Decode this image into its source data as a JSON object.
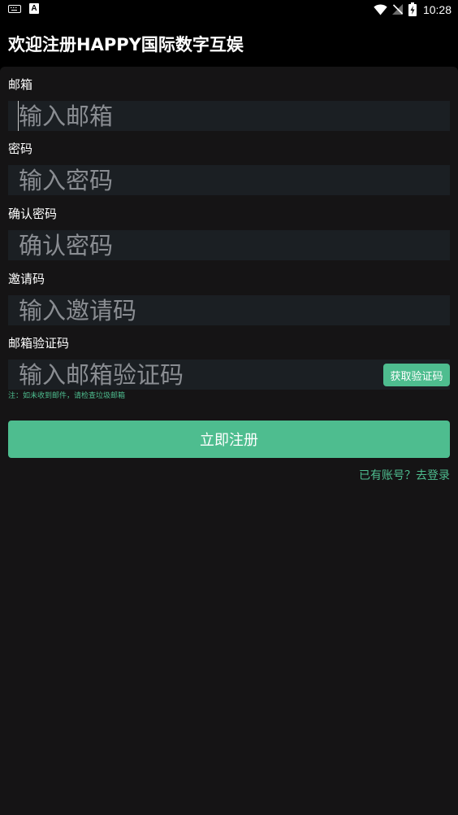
{
  "status_bar": {
    "time": "10:28",
    "left_icons": [
      "keyboard-icon",
      "a-notification-icon"
    ],
    "right_icons": [
      "wifi-icon",
      "no-signal-icon",
      "battery-charging-icon"
    ]
  },
  "header": {
    "title": "欢迎注册HAPPY国际数字互娱"
  },
  "form": {
    "email": {
      "label": "邮箱",
      "placeholder": "输入邮箱"
    },
    "password": {
      "label": "密码",
      "placeholder": "输入密码"
    },
    "confirm_password": {
      "label": "确认密码",
      "placeholder": "确认密码"
    },
    "invite_code": {
      "label": "邀请码",
      "placeholder": "输入邀请码"
    },
    "email_code": {
      "label": "邮箱验证码",
      "placeholder": "输入邮箱验证码",
      "button_label": "获取验证码"
    },
    "hint": "注：如未收到邮件，请检查垃圾邮箱",
    "submit_label": "立即注册",
    "login_link": "已有账号？去登录"
  },
  "colors": {
    "accent": "#4ebd8f",
    "page_background": "#151415",
    "header_background": "#000000",
    "input_background": "#1b1f23",
    "placeholder_text": "#8a8d92"
  }
}
